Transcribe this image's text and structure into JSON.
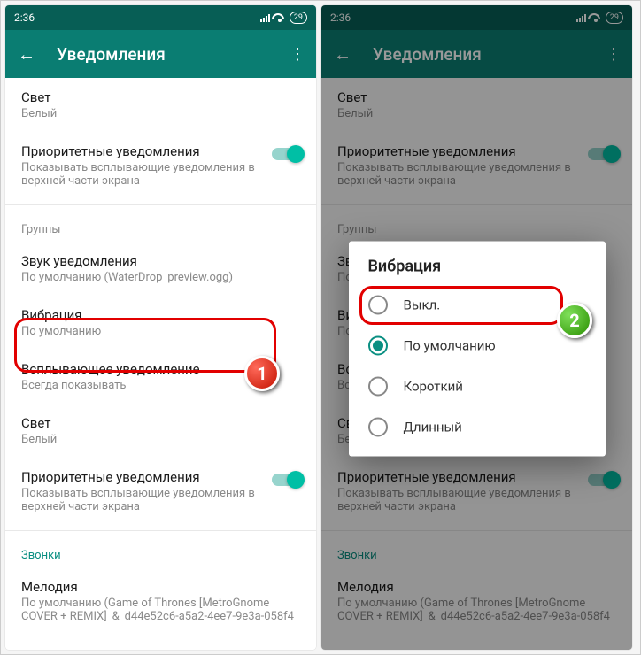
{
  "status": {
    "time": "2:36",
    "battery": "29"
  },
  "header": {
    "title": "Уведомления"
  },
  "settings": {
    "light": {
      "title": "Свет",
      "value": "Белый"
    },
    "priority": {
      "title": "Приоритетные уведомления",
      "desc": "Показывать всплывающие уведомления в верхней части экрана"
    },
    "groups_label": "Группы",
    "sound": {
      "title": "Звук уведомления",
      "value": "По умолчанию (WaterDrop_preview.ogg)"
    },
    "vibration": {
      "title": "Вибрация",
      "value": "По умолчанию"
    },
    "popup": {
      "title": "Всплывающее уведомление",
      "value": "Всегда показывать"
    },
    "light2": {
      "title": "Свет",
      "value": "Белый"
    },
    "priority2": {
      "title": "Приоритетные уведомления",
      "desc": "Показывать всплывающие уведомления в верхней части экрана"
    },
    "calls_label": "Звонки",
    "melody": {
      "title": "Мелодия",
      "value": "По умолчанию (Game of Thrones [MetroGnome COVER + REMIX]_&_d44e52c6-a5a2-4ee7-9e3a-058f4"
    }
  },
  "dialog": {
    "title": "Вибрация",
    "options": [
      "Выкл.",
      "По умолчанию",
      "Короткий",
      "Длинный"
    ],
    "selected": 1
  },
  "badges": {
    "one": "1",
    "two": "2"
  }
}
